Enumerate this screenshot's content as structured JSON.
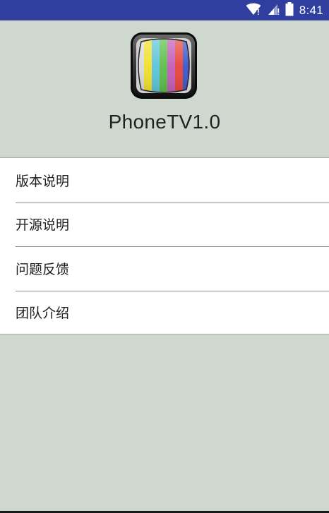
{
  "status_bar": {
    "time": "8:41",
    "icons": [
      "wifi-icon",
      "signal-icon",
      "battery-icon"
    ],
    "color": "#303f9f"
  },
  "header": {
    "app_icon": "tv-icon",
    "title": "PhoneTV1.0"
  },
  "menu": {
    "items": [
      {
        "label": "版本说明"
      },
      {
        "label": "开源说明"
      },
      {
        "label": "问题反馈"
      },
      {
        "label": "团队介绍"
      }
    ]
  },
  "colors": {
    "background": "#cfd8cf",
    "list_background": "#ffffff",
    "status_bar": "#303f9f"
  }
}
